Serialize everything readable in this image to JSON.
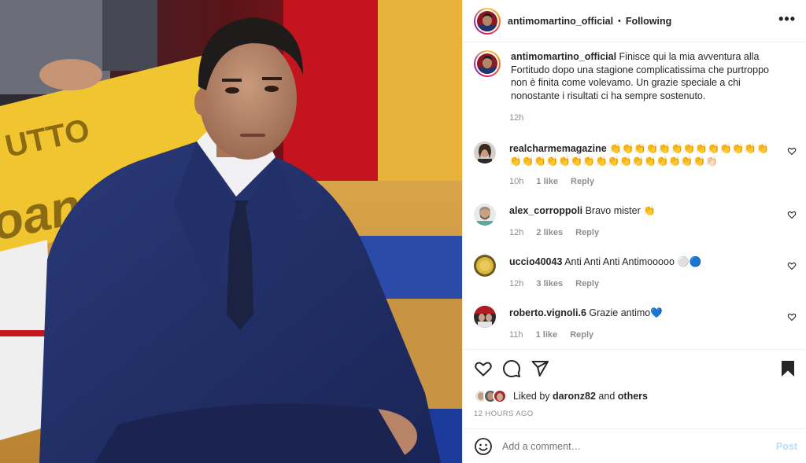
{
  "post": {
    "author": "antimomartino_official",
    "follow_status": "Following",
    "separator": "•",
    "more_icon": "more-horizontal-icon",
    "caption_text": "Finisce qui la mia avventura alla Fortitudo dopo una stagione complicatissima che purtroppo non è finita come volevamo. Un grazie speciale a chi nonostante i risultati ci ha sempre sostenuto.",
    "caption_time": "12h",
    "liked_prefix": "Liked by",
    "liked_user": "daronz82",
    "liked_and": "and",
    "liked_others": "others",
    "posted_ago": "12 HOURS AGO"
  },
  "comments": [
    {
      "user": "realcharmemagazine",
      "text": "👏👏👏👏👏👏👏👏👏👏👏👏👏👏👏👏👏👏👏👏👏👏👏👏👏👏👏👏👏👏🏻",
      "time": "10h",
      "likes": "1 like",
      "reply": "Reply"
    },
    {
      "user": "alex_corroppoli",
      "text": "Bravo mister 👏",
      "time": "12h",
      "likes": "2 likes",
      "reply": "Reply"
    },
    {
      "user": "uccio40043",
      "text": "Anti Anti Anti Antimooooo ⚪🔵",
      "time": "12h",
      "likes": "3 likes",
      "reply": "Reply"
    },
    {
      "user": "roberto.vignoli.6",
      "text": "Grazie antimo💙",
      "time": "11h",
      "likes": "1 like",
      "reply": "Reply"
    }
  ],
  "add_comment": {
    "placeholder": "Add a comment…",
    "post_label": "Post"
  },
  "colors": {
    "text": "#262626",
    "muted": "#8e8e8e",
    "post_disabled": "#b2dffc",
    "border": "#efefef"
  }
}
